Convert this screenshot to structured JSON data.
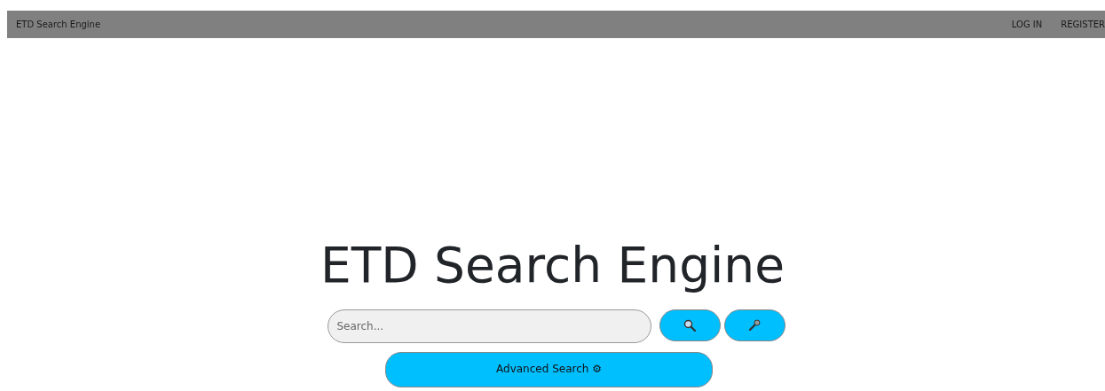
{
  "navbar": {
    "brand": "ETD Search Engine",
    "links": [
      "LOG IN",
      "REGISTER"
    ]
  },
  "title": "ETD Search Engine",
  "search": {
    "placeholder": "Search..."
  },
  "buttons": [
    {
      "kind": "search"
    },
    {
      "kind": "voice"
    }
  ],
  "advanced_button": "Advanced Search ⚙"
}
